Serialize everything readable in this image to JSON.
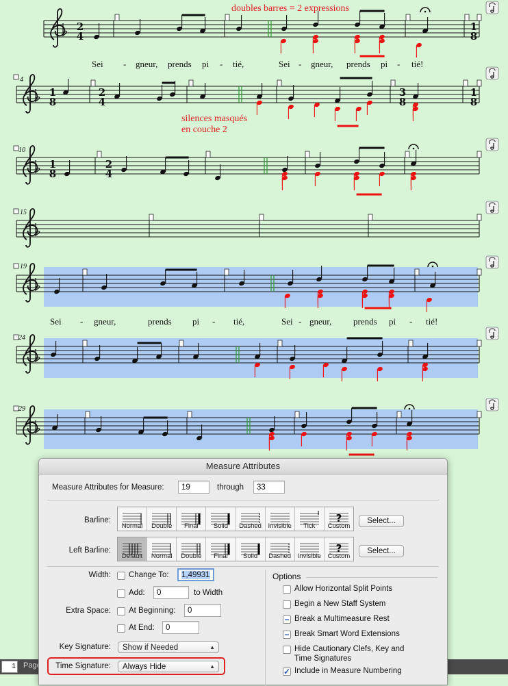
{
  "annotations": {
    "doubles_barres": "doubles barres = 2 expressions",
    "silences_1": "silences masqués",
    "silences_2": "en couche 2"
  },
  "systems": [
    {
      "measure_number": ""
    },
    {
      "measure_number": "4"
    },
    {
      "measure_number": "10"
    },
    {
      "measure_number": "15"
    },
    {
      "measure_number": "19"
    },
    {
      "measure_number": "24"
    },
    {
      "measure_number": "29"
    }
  ],
  "lyrics": [
    "Sei",
    "-",
    "gneur,",
    "prends",
    "pi",
    "-",
    "tié,",
    "Sei",
    "-",
    "gneur,",
    "prends",
    "pi",
    "-",
    "tié!"
  ],
  "time_signatures": {
    "s1_start": [
      "2",
      "4"
    ],
    "s1_end": [
      "1",
      "8"
    ],
    "s2_a": [
      "1",
      "8"
    ],
    "s2_b": [
      "2",
      "4"
    ],
    "s2_c": [
      "3",
      "8"
    ],
    "s2_d": [
      "1",
      "8"
    ],
    "s3_a": [
      "1",
      "8"
    ],
    "s3_b": [
      "2",
      "4"
    ]
  },
  "statusbar": {
    "page_value": "1",
    "page_label": "Page"
  },
  "dialog": {
    "title": "Measure Attributes",
    "for_measure_label": "Measure Attributes for Measure:",
    "from_value": "19",
    "through_label": "through",
    "to_value": "33",
    "barline_label": "Barline:",
    "barline_options": [
      "Normal",
      "Double",
      "Final",
      "Solid",
      "Dashed",
      "Invisible",
      "Tick",
      "Custom"
    ],
    "left_barline_label": "Left Barline:",
    "left_barline_options": [
      "Default",
      "Normal",
      "Double",
      "Final",
      "Solid",
      "Dashed",
      "Invisible",
      "Custom"
    ],
    "select_label": "Select...",
    "width_label": "Width:",
    "change_to_label": "Change To:",
    "change_to_value": "1,49931",
    "add_label": "Add:",
    "add_value": "0",
    "to_width_label": "to Width",
    "extra_space_label": "Extra Space:",
    "at_beginning_label": "At Beginning:",
    "at_beginning_value": "0",
    "at_end_label": "At End:",
    "at_end_value": "0",
    "key_signature_label": "Key Signature:",
    "key_signature_value": "Show if Needed",
    "time_signature_label": "Time Signature:",
    "time_signature_value": "Always Hide",
    "options_title": "Options",
    "options": [
      {
        "label": "Allow Horizontal Split Points",
        "state": "off"
      },
      {
        "label": "Begin a New Staff System",
        "state": "off"
      },
      {
        "label": "Break a Multimeasure Rest",
        "state": "mixed"
      },
      {
        "label": "Break Smart Word Extensions",
        "state": "mixed"
      },
      {
        "label": "Hide Cautionary Clefs, Key and",
        "label2": "Time Signatures",
        "state": "off"
      },
      {
        "label": "Include in Measure Numbering",
        "state": "on"
      }
    ]
  },
  "colors": {
    "background": "#d8f5d8",
    "selection": "#aecbf3",
    "red_notes": "#ee1111",
    "annotation": "#e02020",
    "expression_bar": "#3a9a3a"
  }
}
